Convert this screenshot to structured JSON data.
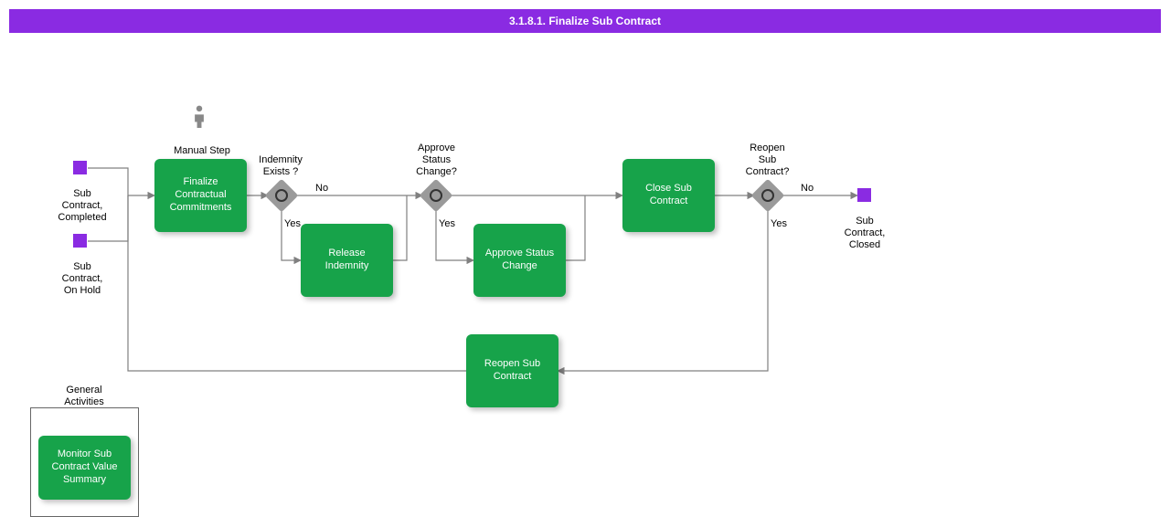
{
  "banner": {
    "title": "3.1.8.1. Finalize Sub Contract"
  },
  "events": {
    "start_completed": "Sub Contract, Completed",
    "start_onhold": "Sub Contract, On Hold",
    "end_closed": "Sub Contract, Closed"
  },
  "annotations": {
    "manual_step": "Manual Step",
    "general_activities": "General Activities"
  },
  "tasks": {
    "finalize": "Finalize Contractual Commitments",
    "release_indemnity": "Release Indemnity",
    "approve_status_change": "Approve Status Change",
    "close_sub_contract": "Close Sub Contract",
    "reopen_sub_contract": "Reopen Sub Contract",
    "monitor": "Monitor Sub Contract Value Summary"
  },
  "gateways": {
    "indemnity_exists": "Indemnity Exists ?",
    "approve_status": "Approve Status Change?",
    "reopen": "Reopen Sub Contract?"
  },
  "edges": {
    "yes": "Yes",
    "no": "No"
  }
}
